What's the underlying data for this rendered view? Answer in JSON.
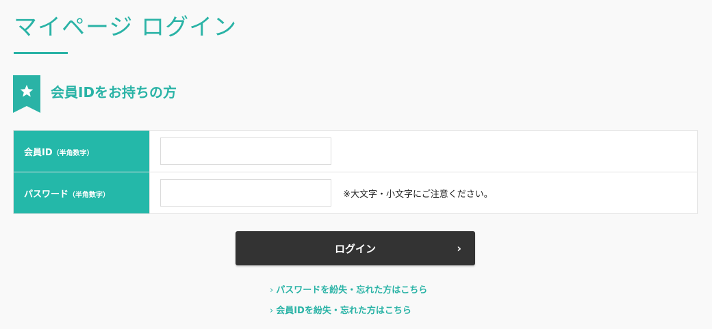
{
  "header": {
    "title": "マイページ ログイン"
  },
  "section": {
    "title": "会員IDをお持ちの方",
    "icon": "star-icon",
    "accent_color": "#2ab3a6"
  },
  "form": {
    "member_id": {
      "label": "会員ID",
      "sub_label": "（半角数字）",
      "value": ""
    },
    "password": {
      "label": "パスワード",
      "sub_label": "（半角数字）",
      "value": "",
      "note": "※大文字・小文字にご注意ください。"
    }
  },
  "actions": {
    "login_label": "ログイン",
    "login_chevron": "›"
  },
  "links": {
    "forgot_password": "パスワードを紛失・忘れた方はこちら",
    "forgot_id": "会員IDを紛失・忘れた方はこちら",
    "prefix": "›"
  }
}
